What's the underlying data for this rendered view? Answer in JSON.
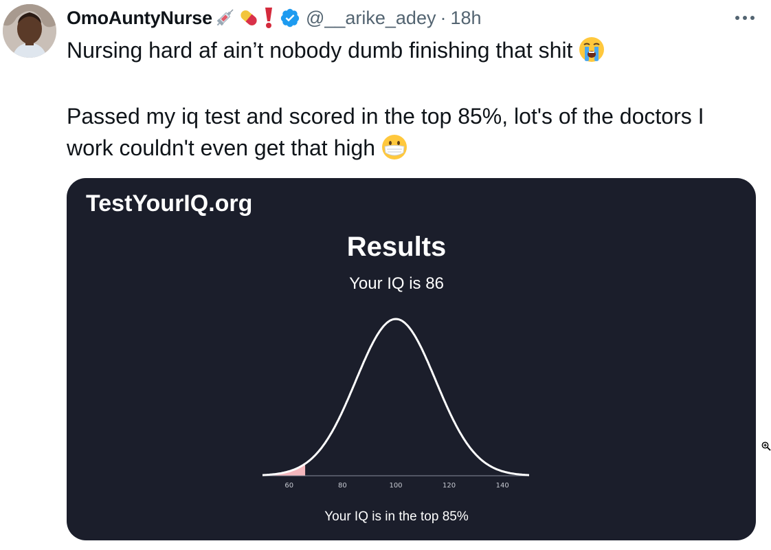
{
  "tweet": {
    "display_name": "OmoAuntyNurse",
    "handle": "@__arike_adey",
    "separator": "·",
    "time": "18h",
    "text_line1": "Nursing hard af ain’t nobody dumb finishing that shit",
    "text_line2": "Passed my iq test and scored in the top 85%, lot's of the doctors I",
    "text_line3": "work couldn't even get that high"
  },
  "card": {
    "brand": "TestYourIQ.org",
    "title": "Results",
    "iq_line": "Your IQ is 86",
    "percentile_text": "Your IQ is in the top 85%"
  },
  "chart_data": {
    "type": "area",
    "distribution": "normal",
    "mean": 100,
    "sd": 15,
    "xlim": [
      50,
      150
    ],
    "x_ticks": [
      60,
      80,
      100,
      120,
      140
    ],
    "shaded_upto": 66,
    "curve_color": "#ffffff",
    "shade_color": "#f4b7bd"
  },
  "colors": {
    "card_bg": "#1b1e2b",
    "verified": "#1d9bf0",
    "muted": "#536471"
  },
  "icons": [
    "syringe-icon",
    "pill-icon",
    "exclamation-icon",
    "verified-badge-icon",
    "more-icon",
    "crying-face-icon",
    "mask-face-icon",
    "zoom-icon"
  ]
}
